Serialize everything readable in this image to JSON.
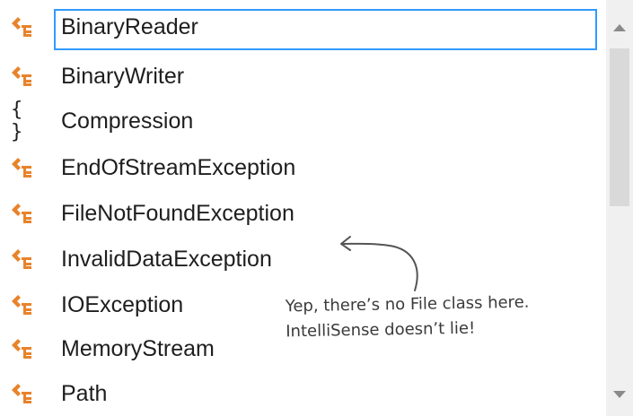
{
  "items": [
    {
      "label": "BinaryReader",
      "icon": "class-icon",
      "selected": true
    },
    {
      "label": "BinaryWriter",
      "icon": "class-icon"
    },
    {
      "label": "Compression",
      "icon": "namespace-icon",
      "glyph": "{ }"
    },
    {
      "label": "EndOfStreamException",
      "icon": "class-icon"
    },
    {
      "label": "FileNotFoundException",
      "icon": "class-icon"
    },
    {
      "label": "InvalidDataException",
      "icon": "class-icon"
    },
    {
      "label": "IOException",
      "icon": "class-icon"
    },
    {
      "label": "MemoryStream",
      "icon": "class-icon"
    },
    {
      "label": "Path",
      "icon": "class-icon"
    }
  ],
  "annotation": {
    "line1": "Yep, there’s no File class here.",
    "line2": "IntelliSense doesn’t lie!"
  },
  "colors": {
    "class_icon": "#e8832a",
    "selection_border": "#3399ff",
    "scroll_thumb": "#d9d9d9",
    "scroll_track": "#f0f0f0"
  }
}
